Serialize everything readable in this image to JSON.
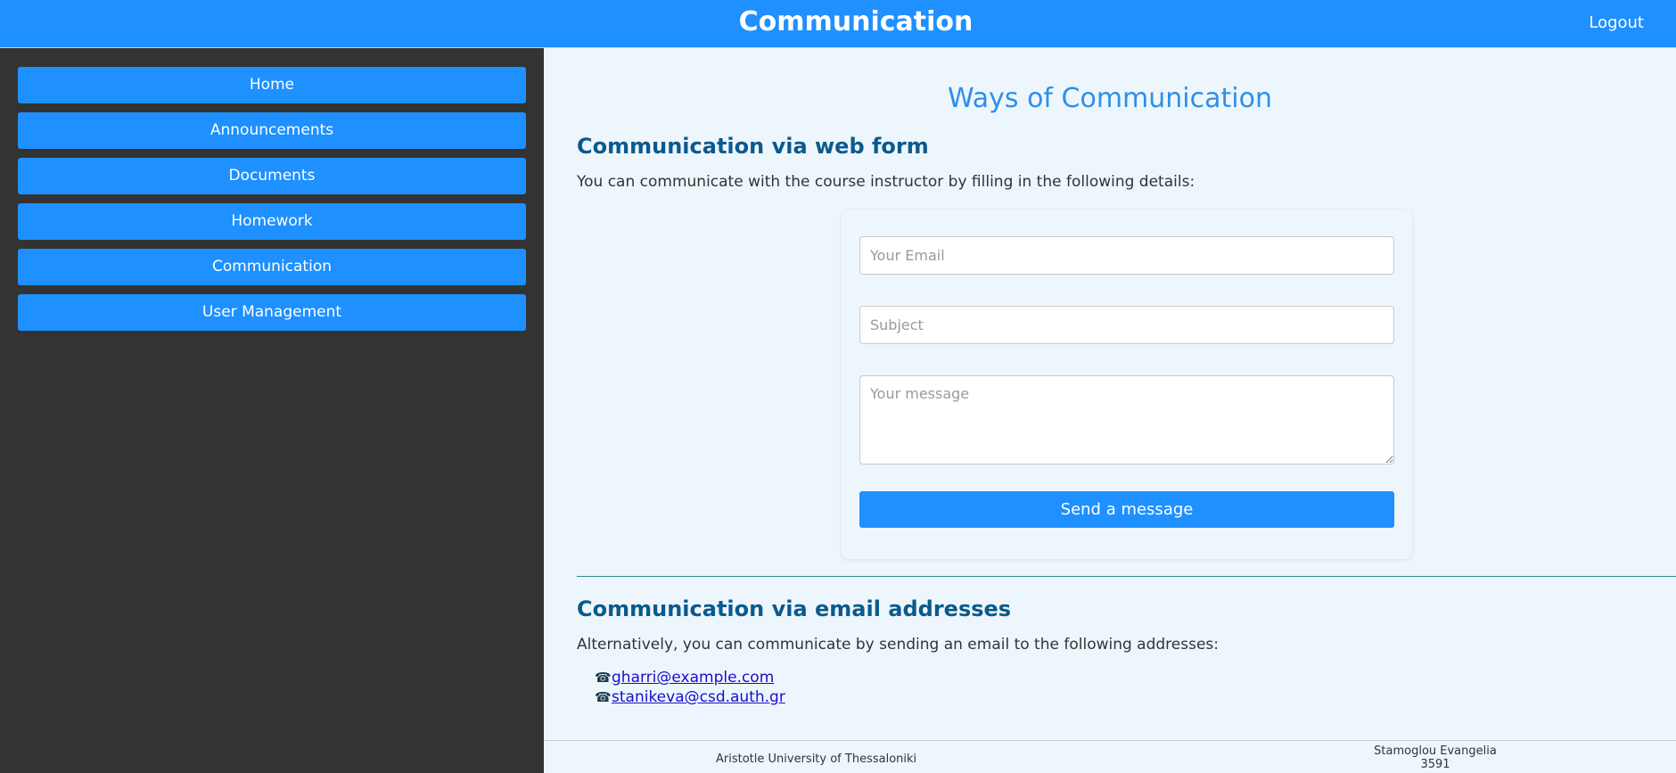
{
  "header": {
    "title": "Communication",
    "logout_label": "Logout"
  },
  "sidebar": {
    "items": [
      {
        "label": "Home"
      },
      {
        "label": "Announcements"
      },
      {
        "label": "Documents"
      },
      {
        "label": "Homework"
      },
      {
        "label": "Communication"
      },
      {
        "label": "User Management"
      }
    ]
  },
  "main": {
    "page_title": "Ways of Communication",
    "web_form": {
      "heading": "Communication via web form",
      "intro": "You can communicate with the course instructor by filling in the following details:",
      "email_placeholder": "Your Email",
      "subject_placeholder": "Subject",
      "message_placeholder": "Your message",
      "send_label": "Send a message"
    },
    "email_section": {
      "heading": "Communication via email addresses",
      "intro": "Alternatively, you can communicate by sending an email to the following addresses:",
      "icon": "phone-icon",
      "addresses": [
        "gharri@example.com",
        "stanikeva@csd.auth.gr"
      ]
    }
  },
  "footer": {
    "university": "Aristotle University of Thessaloniki",
    "author_name": "Stamoglou Evangelia",
    "author_id": "3591"
  },
  "colors": {
    "accent": "#1e90ff",
    "sidebar_bg": "#333333",
    "heading": "#0a5a8e",
    "page_bg": "#eef6fd"
  }
}
